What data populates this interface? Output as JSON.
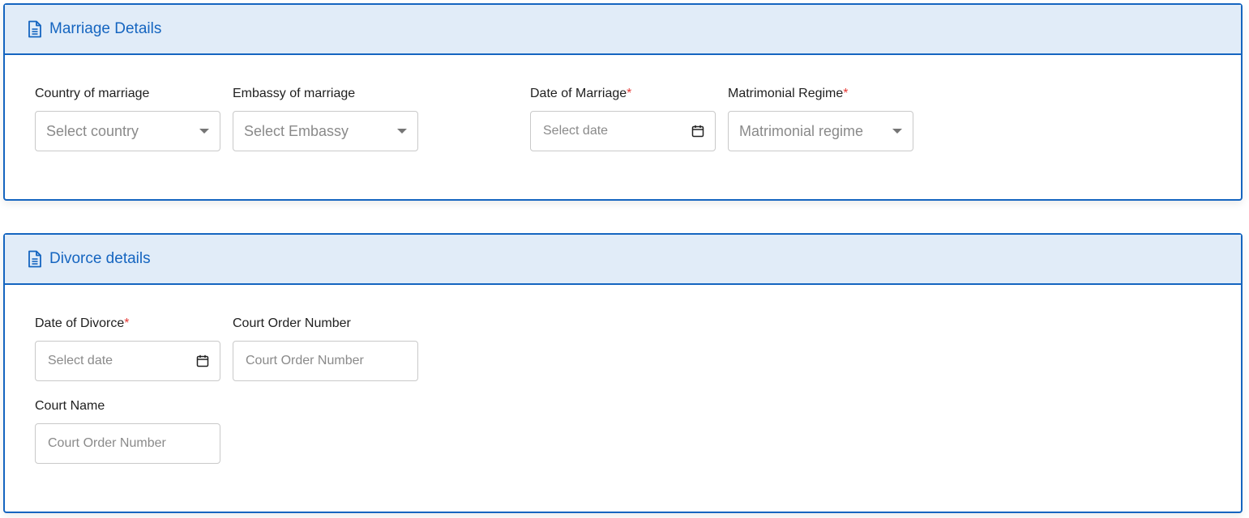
{
  "marriage": {
    "title": "Marriage Details",
    "icon": "document-icon",
    "fields": {
      "country": {
        "label": "Country of marriage",
        "placeholder": "Select country"
      },
      "embassy": {
        "label": "Embassy of marriage",
        "placeholder": "Select Embassy"
      },
      "date": {
        "label": "Date of Marriage",
        "required_mark": "*",
        "placeholder": "Select date"
      },
      "regime": {
        "label": "Matrimonial Regime",
        "required_mark": "*",
        "placeholder": "Matrimonial regime"
      }
    }
  },
  "divorce": {
    "title": "Divorce details",
    "icon": "document-icon",
    "fields": {
      "date": {
        "label": "Date of Divorce",
        "required_mark": "*",
        "placeholder": "Select date"
      },
      "court_order": {
        "label": "Court Order Number",
        "placeholder": "Court Order Number"
      },
      "court_name": {
        "label": "Court Name",
        "placeholder": "Court Order Number"
      }
    }
  },
  "colors": {
    "accent": "#1565c0",
    "header_bg": "#e1ecf8",
    "required": "#e53935",
    "border": "#c9c9c9"
  }
}
